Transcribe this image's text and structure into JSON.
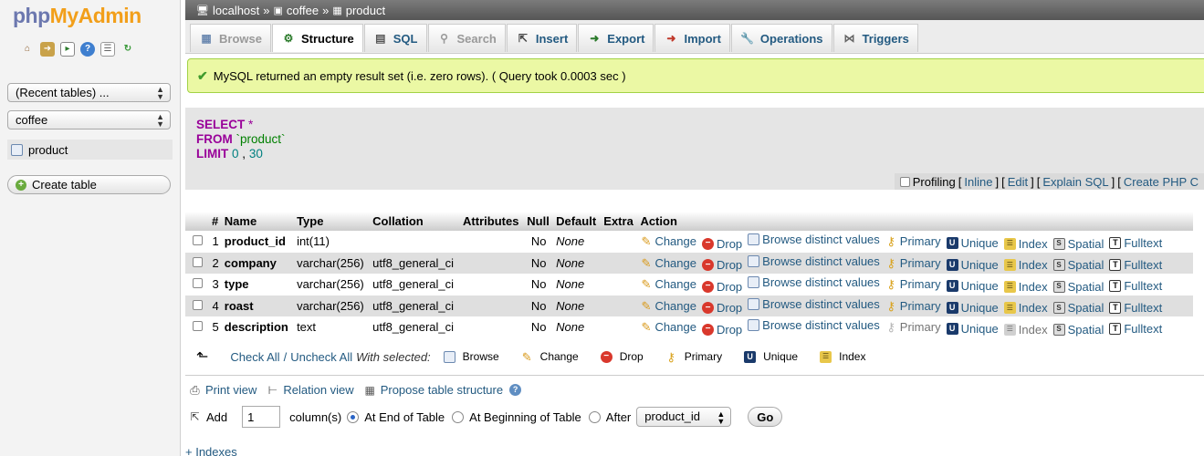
{
  "nav": {
    "logo_part1": "php",
    "logo_part2": "MyAdmin",
    "icons": [
      "home-icon",
      "exit-icon",
      "query-window-icon",
      "help-icon",
      "docs-icon",
      "reload-icon"
    ],
    "recent_tables": "(Recent tables) ...",
    "database_select": "coffee",
    "table_item": "product",
    "create_table": "Create table"
  },
  "breadcrumb": {
    "server": "localhost",
    "sep1": "»",
    "database": "coffee",
    "sep2": "»",
    "table": "product"
  },
  "tabs": [
    {
      "label": "Browse",
      "icon": "browse-icon",
      "state": "disabled"
    },
    {
      "label": "Structure",
      "icon": "structure-icon",
      "state": "active"
    },
    {
      "label": "SQL",
      "icon": "sql-icon",
      "state": "normal"
    },
    {
      "label": "Search",
      "icon": "search-icon",
      "state": "disabled"
    },
    {
      "label": "Insert",
      "icon": "insert-icon",
      "state": "normal"
    },
    {
      "label": "Export",
      "icon": "export-icon",
      "state": "normal"
    },
    {
      "label": "Import",
      "icon": "import-icon",
      "state": "normal"
    },
    {
      "label": "Operations",
      "icon": "operations-icon",
      "state": "normal"
    },
    {
      "label": "Triggers",
      "icon": "triggers-icon",
      "state": "normal"
    }
  ],
  "message": "MySQL returned an empty result set (i.e. zero rows). ( Query took 0.0003 sec )",
  "sql": {
    "select": "SELECT",
    "star": "*",
    "from": "FROM",
    "table": "`product`",
    "limit": "LIMIT",
    "offset": "0",
    "comma": ",",
    "count": "30"
  },
  "sql_links": {
    "profiling": "Profiling",
    "inline": "Inline",
    "edit": "Edit",
    "explain": "Explain SQL",
    "create_php": "Create PHP C"
  },
  "structure": {
    "headers": [
      "#",
      "Name",
      "Type",
      "Collation",
      "Attributes",
      "Null",
      "Default",
      "Extra",
      "Action"
    ],
    "rows": [
      {
        "num": "1",
        "name": "product_id",
        "type": "int(11)",
        "collation": "",
        "attributes": "",
        "null": "No",
        "default": "None",
        "extra": ""
      },
      {
        "num": "2",
        "name": "company",
        "type": "varchar(256)",
        "collation": "utf8_general_ci",
        "attributes": "",
        "null": "No",
        "default": "None",
        "extra": ""
      },
      {
        "num": "3",
        "name": "type",
        "type": "varchar(256)",
        "collation": "utf8_general_ci",
        "attributes": "",
        "null": "No",
        "default": "None",
        "extra": ""
      },
      {
        "num": "4",
        "name": "roast",
        "type": "varchar(256)",
        "collation": "utf8_general_ci",
        "attributes": "",
        "null": "No",
        "default": "None",
        "extra": ""
      },
      {
        "num": "5",
        "name": "description",
        "type": "text",
        "collation": "utf8_general_ci",
        "attributes": "",
        "null": "No",
        "default": "None",
        "extra": ""
      }
    ],
    "actions": {
      "change": "Change",
      "drop": "Drop",
      "browse": "Browse distinct values",
      "primary": "Primary",
      "unique": "Unique",
      "index": "Index",
      "spatial": "Spatial",
      "fulltext": "Fulltext"
    }
  },
  "with_selected": {
    "check_all": "Check All",
    "slash": "/",
    "uncheck_all": "Uncheck All",
    "label": "With selected:",
    "browse": "Browse",
    "change": "Change",
    "drop": "Drop",
    "primary": "Primary",
    "unique": "Unique",
    "index": "Index"
  },
  "bottom": {
    "print_view": "Print view",
    "relation_view": "Relation view",
    "propose": "Propose table structure",
    "add": "Add",
    "add_count": "1",
    "columns": "column(s)",
    "at_end": "At End of Table",
    "at_beginning": "At Beginning of Table",
    "after": "After",
    "after_column": "product_id",
    "go": "Go",
    "indexes": "+ Indexes"
  }
}
